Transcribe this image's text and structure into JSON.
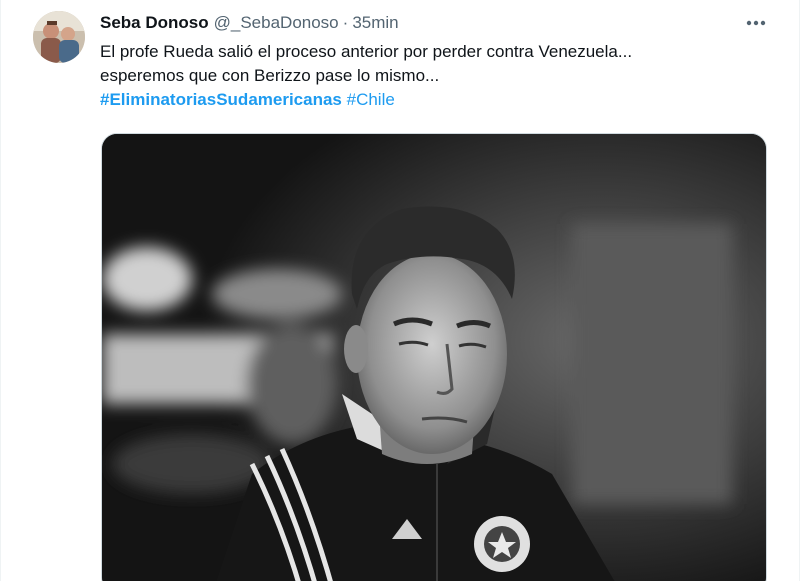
{
  "author": {
    "name": "Seba Donoso",
    "handle": "@_SebaDonoso",
    "separator": "·",
    "time": "35min"
  },
  "tweet": {
    "line1": "El profe Rueda salió el proceso anterior por perder contra Venezuela...",
    "line2": "esperemos que con Berizzo pase lo mismo...",
    "hashtag1": "#EliminatoriasSudamericanas",
    "hashtag2": "#Chile"
  },
  "icons": {
    "more": "more-options-icon",
    "avatar": "avatar-image"
  },
  "media": {
    "style": "black-and-white photo"
  },
  "colors": {
    "text": "#0f1419",
    "muted": "#536471",
    "link": "#1d9bf0",
    "border": "#cfd9de"
  }
}
